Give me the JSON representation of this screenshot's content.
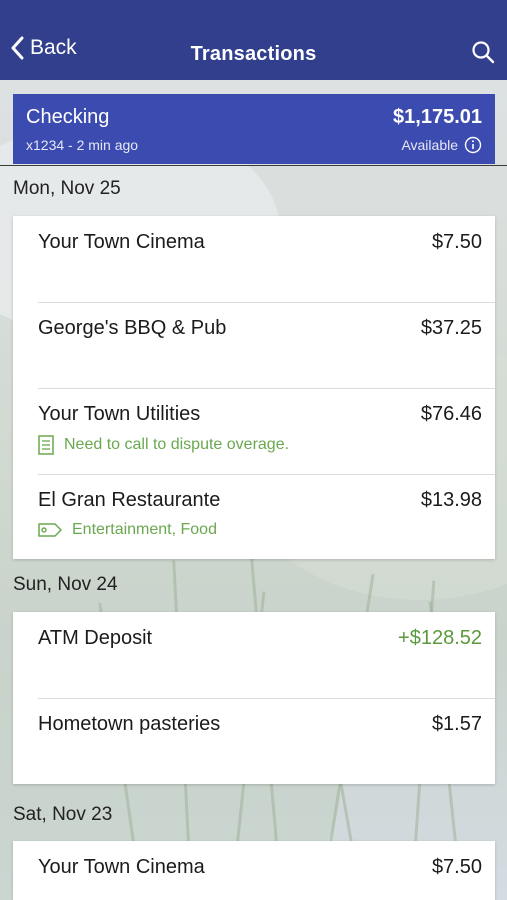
{
  "nav": {
    "back_label": "Back",
    "title": "Transactions",
    "search_icon": "search-icon"
  },
  "account": {
    "name": "Checking",
    "balance": "$1,175.01",
    "subtitle": "x1234 - 2 min ago",
    "available_label": "Available"
  },
  "groups": [
    {
      "date": "Mon, Nov 25",
      "transactions": [
        {
          "name": "Your Town Cinema",
          "amount": "$7.50"
        },
        {
          "name": "George's BBQ & Pub",
          "amount": "$37.25"
        },
        {
          "name": "Your Town Utilities",
          "amount": "$76.46",
          "note": "Need to call to dispute overage.",
          "note_icon": "note-icon"
        },
        {
          "name": "El Gran Restaurante",
          "amount": "$13.98",
          "note": "Entertainment, Food",
          "note_icon": "tag-icon"
        }
      ]
    },
    {
      "date": "Sun, Nov 24",
      "transactions": [
        {
          "name": "ATM Deposit",
          "amount": "+$128.52",
          "credit": true
        },
        {
          "name": "Hometown pasteries",
          "amount": "$1.57"
        }
      ]
    },
    {
      "date": "Sat, Nov 23",
      "transactions": [
        {
          "name": "Your Town Cinema",
          "amount": "$7.50"
        }
      ]
    }
  ],
  "colors": {
    "nav_bg": "#313f8d",
    "account_bg": "#3c4bb0",
    "credit": "#5a9a3c",
    "note": "#6aa84f"
  }
}
